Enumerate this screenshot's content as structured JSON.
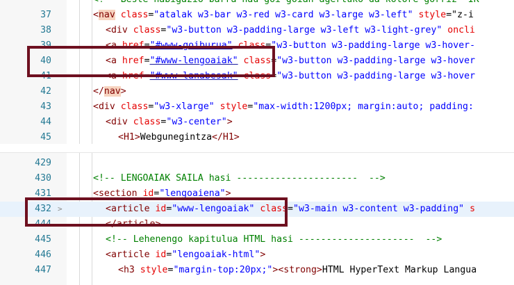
{
  "top": {
    "lines": [
      {
        "n": "37",
        "partial": true,
        "indent": 0,
        "segs": [
          [
            "t-bracket",
            "<"
          ],
          [
            "t-tag navmatch",
            "nav"
          ],
          [
            "t-attr",
            " class"
          ],
          [
            "t-text",
            "="
          ],
          [
            "t-val",
            "\"atalak w3-bar w3-red w3-card w3-large w3-left\""
          ],
          [
            "t-attr",
            " style"
          ],
          [
            "t-text",
            "=\"z-i"
          ]
        ]
      },
      {
        "n": "38",
        "indent": 1,
        "segs": [
          [
            "t-bracket",
            "<"
          ],
          [
            "t-tag",
            "div"
          ],
          [
            "t-attr",
            " class"
          ],
          [
            "t-text",
            "="
          ],
          [
            "t-val",
            "\"w3-button w3-padding-large w3-left w3-light-grey\""
          ],
          [
            "t-attr",
            " oncli"
          ]
        ]
      },
      {
        "n": "39",
        "indent": 1,
        "segs": [
          [
            "t-bracket",
            "<"
          ],
          [
            "t-tag",
            "a"
          ],
          [
            "t-attr",
            " href"
          ],
          [
            "t-text",
            "="
          ],
          [
            "t-val strike-val",
            "\"#www-goiburua\""
          ],
          [
            "t-attr",
            " class"
          ],
          [
            "t-text",
            "="
          ],
          [
            "t-val",
            "\"w3-button w3-padding-large w3-hover-"
          ]
        ]
      },
      {
        "n": "40",
        "indent": 1,
        "segs": [
          [
            "t-bracket",
            "<"
          ],
          [
            "t-tag",
            "a"
          ],
          [
            "t-attr",
            " href"
          ],
          [
            "t-text",
            "="
          ],
          [
            "t-val strike-val",
            "\"#www-lengoaiak\""
          ],
          [
            "t-attr",
            " class"
          ],
          [
            "t-text",
            "="
          ],
          [
            "t-val",
            "\"w3-button w3-padding-large w3-hover"
          ]
        ]
      },
      {
        "n": "41",
        "indent": 1,
        "segs": [
          [
            "t-bracket",
            "<"
          ],
          [
            "t-tag",
            "a"
          ],
          [
            "t-attr",
            " href"
          ],
          [
            "t-text",
            "="
          ],
          [
            "t-val strike-val",
            "\"#www-lanabesak\""
          ],
          [
            "t-attr",
            " class"
          ],
          [
            "t-text",
            "="
          ],
          [
            "t-val",
            "\"w3-button w3-padding-large w3-hover"
          ]
        ]
      },
      {
        "n": "42",
        "indent": 0,
        "segs": [
          [
            "t-bracket",
            "</"
          ],
          [
            "t-tag navmatch",
            "nav"
          ],
          [
            "t-bracket",
            ">"
          ]
        ]
      },
      {
        "n": "43",
        "indent": 0,
        "segs": [
          [
            "t-bracket",
            "<"
          ],
          [
            "t-tag",
            "div"
          ],
          [
            "t-attr",
            " class"
          ],
          [
            "t-text",
            "="
          ],
          [
            "t-val",
            "\"w3-xlarge\""
          ],
          [
            "t-attr",
            " style"
          ],
          [
            "t-text",
            "="
          ],
          [
            "t-val",
            "\"max-width:1200px; margin:auto; padding:"
          ]
        ]
      },
      {
        "n": "44",
        "indent": 1,
        "segs": [
          [
            "t-bracket",
            "<"
          ],
          [
            "t-tag",
            "div"
          ],
          [
            "t-attr",
            " class"
          ],
          [
            "t-text",
            "="
          ],
          [
            "t-val",
            "\"w3-center\""
          ],
          [
            "t-bracket",
            ">"
          ]
        ]
      },
      {
        "n": "45",
        "indent": 2,
        "segs": [
          [
            "t-bracket",
            "<"
          ],
          [
            "t-tag",
            "H1"
          ],
          [
            "t-bracket",
            ">"
          ],
          [
            "t-text",
            "Webgunegintza"
          ],
          [
            "t-bracket",
            "</"
          ],
          [
            "t-tag",
            "H1"
          ],
          [
            "t-bracket",
            ">"
          ]
        ]
      }
    ],
    "partial_first": "<!-- Beste nabigazio-barra nau goi-goian agertuko da kolore gorriz  IK"
  },
  "bottom": {
    "lines": [
      {
        "n": "429",
        "indent": 0,
        "segs": []
      },
      {
        "n": "430",
        "indent": 0,
        "segs": [
          [
            "t-comment",
            "<!-- LENGOAIAK SAILA hasi ----------------------  -->"
          ]
        ]
      },
      {
        "n": "431",
        "indent": 0,
        "segs": [
          [
            "t-bracket",
            "<"
          ],
          [
            "t-tag",
            "section"
          ],
          [
            "t-attr",
            " id"
          ],
          [
            "t-text",
            "="
          ],
          [
            "t-val",
            "\"lengoaiena\""
          ],
          [
            "t-bracket",
            ">"
          ]
        ]
      },
      {
        "n": "432",
        "indent": 1,
        "hl": true,
        "fold": ">",
        "segs": [
          [
            "t-bracket",
            "<"
          ],
          [
            "t-tag",
            "article"
          ],
          [
            "t-attr",
            " id"
          ],
          [
            "t-text",
            "="
          ],
          [
            "t-val",
            "\"www-lengoaiak\""
          ],
          [
            "t-attr",
            " class"
          ],
          [
            "t-text",
            "="
          ],
          [
            "t-val",
            "\"w3-main w3-content w3-padding\""
          ],
          [
            "t-attr",
            " s"
          ]
        ]
      },
      {
        "n": "444",
        "indent": 1,
        "segs": [
          [
            "t-bracket",
            "</"
          ],
          [
            "t-tag",
            "article"
          ],
          [
            "t-bracket",
            ">"
          ]
        ]
      },
      {
        "n": "445",
        "indent": 1,
        "segs": [
          [
            "t-comment",
            "<!-- Lehenengo kapitulua HTML hasi ---------------------  -->"
          ]
        ]
      },
      {
        "n": "446",
        "indent": 1,
        "segs": [
          [
            "t-bracket",
            "<"
          ],
          [
            "t-tag",
            "article"
          ],
          [
            "t-attr",
            " id"
          ],
          [
            "t-text",
            "="
          ],
          [
            "t-val",
            "\"lengoaiak-html\""
          ],
          [
            "t-bracket",
            ">"
          ]
        ]
      },
      {
        "n": "447",
        "indent": 2,
        "segs": [
          [
            "t-bracket",
            "<"
          ],
          [
            "t-tag",
            "h3"
          ],
          [
            "t-attr",
            " style"
          ],
          [
            "t-text",
            "="
          ],
          [
            "t-val",
            "\"margin-top:20px;\""
          ],
          [
            "t-bracket",
            ">"
          ],
          [
            "t-bracket",
            "<"
          ],
          [
            "t-tag",
            "strong"
          ],
          [
            "t-bracket",
            ">"
          ],
          [
            "t-text",
            "HTML HyperText Markup Langua"
          ]
        ]
      }
    ]
  },
  "callouts": [
    {
      "name": "callout-line-40",
      "label": "line 40 highlight"
    },
    {
      "name": "callout-line-432",
      "label": "line 432 highlight"
    }
  ]
}
